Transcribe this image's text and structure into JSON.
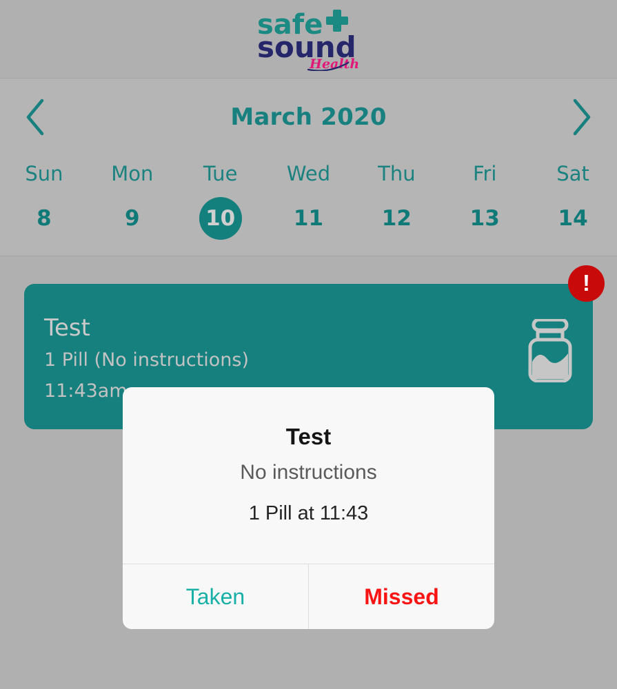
{
  "brand": {
    "word_one": "safe",
    "word_two": "sound",
    "tagline": "Health",
    "plus_icon": "medical-cross-icon",
    "colors": {
      "teal": "#1b8a83",
      "navy": "#26276b",
      "pink": "#e0187a"
    }
  },
  "calendar": {
    "prev_icon": "chevron-left-icon",
    "next_icon": "chevron-right-icon",
    "month_label": "March 2020",
    "weekdays": [
      "Sun",
      "Mon",
      "Tue",
      "Wed",
      "Thu",
      "Fri",
      "Sat"
    ],
    "dates": [
      "8",
      "9",
      "10",
      "11",
      "12",
      "13",
      "14"
    ],
    "selected_index": 2,
    "accent_color": "#18817f"
  },
  "medication_card": {
    "name": "Test",
    "dose": "1 Pill (No instructions)",
    "time": "11:43am",
    "icon": "pill-jar-icon",
    "alert_badge": "!",
    "alert_color": "#c90a0a",
    "card_color": "#16807e"
  },
  "dialog": {
    "title": "Test",
    "subtitle": "No instructions",
    "detail": "1 Pill at 11:43",
    "actions": {
      "taken_label": "Taken",
      "taken_color": "#17b0a6",
      "missed_label": "Missed",
      "missed_color": "#fa1414"
    }
  }
}
